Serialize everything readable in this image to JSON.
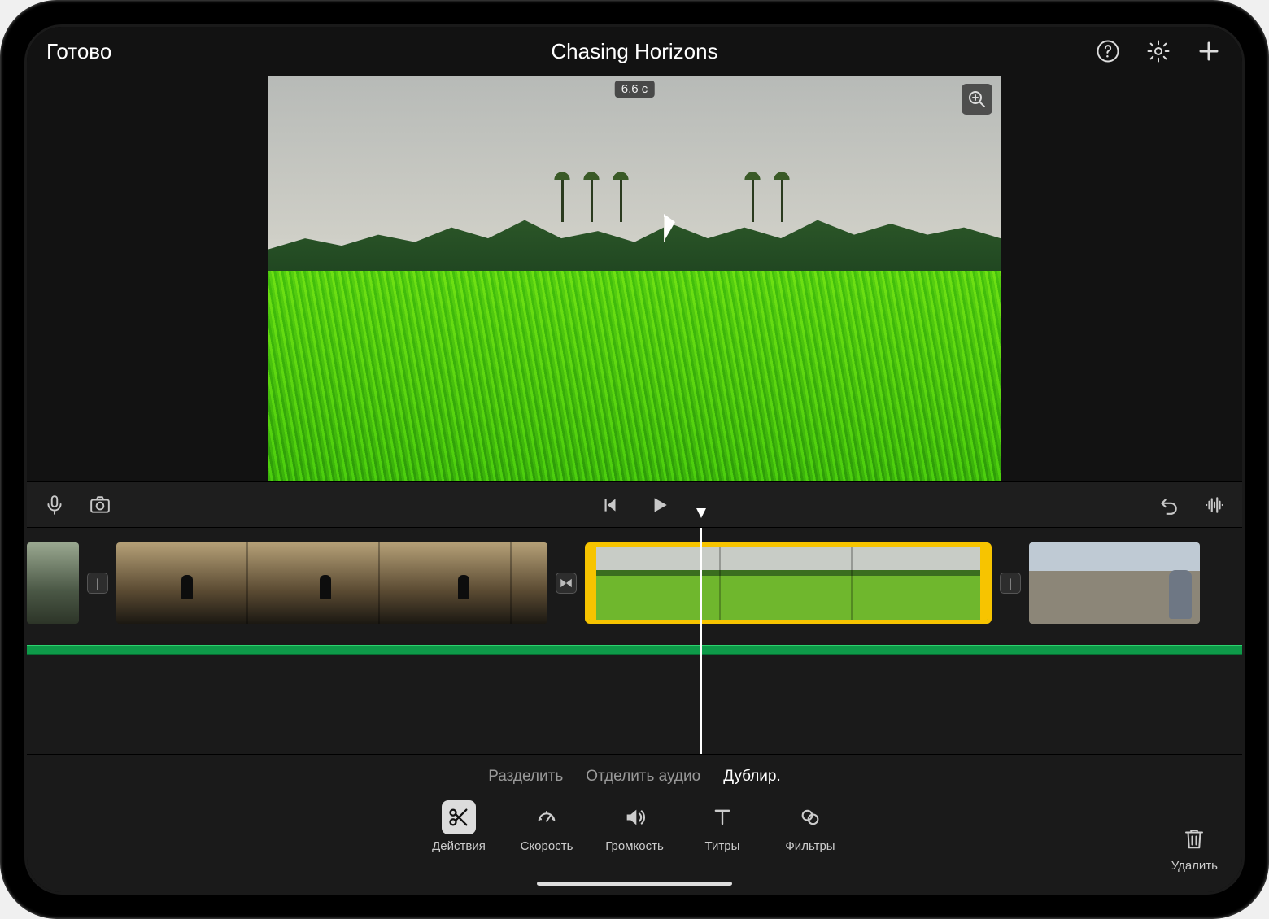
{
  "header": {
    "done_label": "Готово",
    "project_title": "Chasing Horizons"
  },
  "viewer": {
    "timecode": "6,6 c"
  },
  "actions": {
    "split": "Разделить",
    "detach_audio": "Отделить аудио",
    "duplicate": "Дублир."
  },
  "tools": {
    "actions": "Действия",
    "speed": "Скорость",
    "volume": "Громкость",
    "titles": "Титры",
    "filters": "Фильтры"
  },
  "delete_label": "Удалить",
  "icons": {
    "help": "help-icon",
    "settings": "gear-icon",
    "add": "plus-icon",
    "mic": "microphone-icon",
    "camera": "camera-icon",
    "prev": "skip-back-icon",
    "play": "play-icon",
    "undo": "undo-icon",
    "waveform": "waveform-icon",
    "zoom": "magnifier-plus-icon",
    "scissors": "scissors-icon",
    "speed": "speedometer-icon",
    "volume": "speaker-icon",
    "titles": "text-icon",
    "filters": "circles-icon",
    "trash": "trash-icon"
  }
}
